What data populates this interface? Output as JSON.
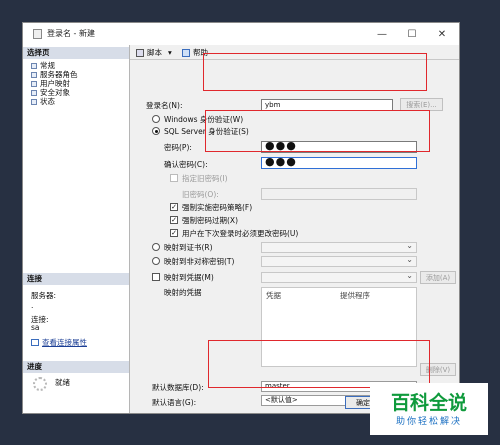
{
  "window": {
    "title": "登录名 - 新建",
    "min": "—",
    "max": "☐",
    "close": "✕"
  },
  "left": {
    "select_page_header": "选择页",
    "pages": [
      "常规",
      "服务器角色",
      "用户映射",
      "安全对象",
      "状态"
    ],
    "connection_header": "连接",
    "server_label": "服务器:",
    "server_value": ".",
    "connection_label": "连接:",
    "connection_value": "sa",
    "view_props_link": "查看连接属性",
    "progress_header": "进度",
    "progress_status": "就绪"
  },
  "toolbar": {
    "script_label": "脚本",
    "help_label": "帮助"
  },
  "form": {
    "login_name_label": "登录名(N):",
    "login_name_value": "ybm",
    "search_button": "搜索(E)...",
    "windows_auth": "Windows 身份验证(W)",
    "sql_auth": "SQL Server 身份验证(S)",
    "password_label": "密码(P):",
    "password_value": "●●●",
    "confirm_label": "确认密码(C):",
    "confirm_value": "●●●",
    "specify_old": "指定旧密码(I)",
    "old_password": "旧密码(O):",
    "enforce_policy": "强制实施密码策略(F)",
    "enforce_expire": "强制密码过期(X)",
    "must_change": "用户在下次登录时必须更改密码(U)",
    "map_cert": "映射到证书(R)",
    "map_asym": "映射到非对称密钥(T)",
    "map_cred": "映射到凭据(M)",
    "add_button": "添加(A)",
    "mapped_creds": "映射的凭据",
    "cred_col": "凭据",
    "provider_col": "提供程序",
    "remove_button": "删除(V)",
    "default_db_label": "默认数据库(D):",
    "default_db_value": "master",
    "default_lang_label": "默认语言(G):",
    "default_lang_value": "<默认值>"
  },
  "footer": {
    "ok_label": "确定"
  },
  "watermark": {
    "line1": "百科全说",
    "line2": "助你轻松解决"
  }
}
